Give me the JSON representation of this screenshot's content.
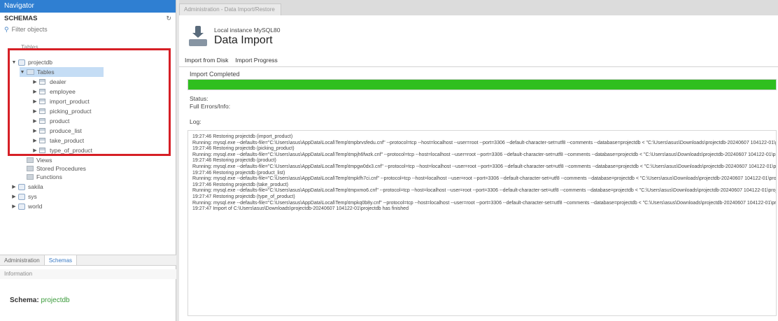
{
  "navigator": {
    "title": "Navigator",
    "schemas_label": "SCHEMAS",
    "filter_placeholder": "Filter objects"
  },
  "tree": {
    "partial_top": "Tables",
    "db_name": "projectdb",
    "tables_label": "Tables",
    "tables": [
      "dealer",
      "employee",
      "import_product",
      "picking_product",
      "product",
      "produce_list",
      "take_product",
      "type_of_product"
    ],
    "views_label": "Views",
    "procs_label": "Stored Procedures",
    "funcs_label": "Functions",
    "other_dbs": [
      "sakila",
      "sys",
      "world"
    ]
  },
  "bottom_tabs": [
    "Administration",
    "Schemas"
  ],
  "info_header": "Information",
  "schema_info": {
    "label": "Schema:",
    "value": "projectdb"
  },
  "doc_tab": "Administration - Data Import/Restore",
  "import": {
    "subtitle": "Local instance MySQL80",
    "title": "Data Import",
    "tabs": [
      "Import from Disk",
      "Import Progress"
    ],
    "status_text": "Import Completed",
    "progress": 1.0,
    "status_label": "Status:",
    "log_label_top": "Full Errors/Info:",
    "log_label": "Log:"
  },
  "log_lines": [
    "19:27:46 Restoring projectdb (import_product)",
    "Running: mysql.exe --defaults-file=\"C:\\Users\\asus\\AppData\\Local\\Temp\\tmpbrvsfedu.cnf\"  --protocol=tcp --host=localhost --user=root --port=3306 --default-character-set=utf8 --comments --database=projectdb < \"C:\\Users\\asus\\Downloads\\projectdb-20240607 104122-01\\projectdb\\projectdb_import_product.sql\"",
    "19:27:46 Restoring projectdb (picking_product)",
    "Running: mysql.exe --defaults-file=\"C:\\Users\\asus\\AppData\\Local\\Temp\\tmpjh6fwzk.cnf\"  --protocol=tcp --host=localhost --user=root --port=3306 --default-character-set=utf8 --comments --database=projectdb < \"C:\\Users\\asus\\Downloads\\projectdb-20240607 104122-01\\projectdb\\projectdb_picking_product.sql\"",
    "19:27:46 Restoring projectdb (product)",
    "Running: mysql.exe --defaults-file=\"C:\\Users\\asus\\AppData\\Local\\Temp\\tmpgw0dx3.cnf\"  --protocol=tcp --host=localhost --user=root --port=3306 --default-character-set=utf8 --comments --database=projectdb < \"C:\\Users\\asus\\Downloads\\projectdb-20240607 104122-01\\projectdb\\projectdb_product.sql\"",
    "19:27:46 Restoring projectdb (product_list)",
    "Running: mysql.exe --defaults-file=\"C:\\Users\\asus\\AppData\\Local\\Temp\\tmpkfh7ci.cnf\"  --protocol=tcp --host=localhost --user=root --port=3306 --default-character-set=utf8 --comments --database=projectdb < \"C:\\Users\\asus\\Downloads\\projectdb-20240607 104122-01\\projectdb\\projectdb_product_list.sql\"",
    "19:27:46 Restoring projectdb (take_product)",
    "Running: mysql.exe --defaults-file=\"C:\\Users\\asus\\AppData\\Local\\Temp\\tmpxmo6.cnf\"  --protocol=tcp --host=localhost --user=root --port=3306 --default-character-set=utf8 --comments --database=projectdb < \"C:\\Users\\asus\\Downloads\\projectdb-20240607 104122-01\\projectdb\\projectdb_take_product.sql\"",
    "19:27:47 Restoring projectdb (type_of_product)",
    "Running: mysql.exe --defaults-file=\"C:\\Users\\asus\\AppData\\Local\\Temp\\tmpkq0b8y.cnf\"  --protocol=tcp --host=localhost --user=root --port=3306 --default-character-set=utf8 --comments --database=projectdb < \"C:\\Users\\asus\\Downloads\\projectdb-20240607 104122-01\\projectdb\\projectdb_type_of_product.sql\"",
    "19:27:47 Import of C:\\Users\\asus\\Downloads\\projectdb-20240607 104122-01\\projectdb has finished"
  ]
}
